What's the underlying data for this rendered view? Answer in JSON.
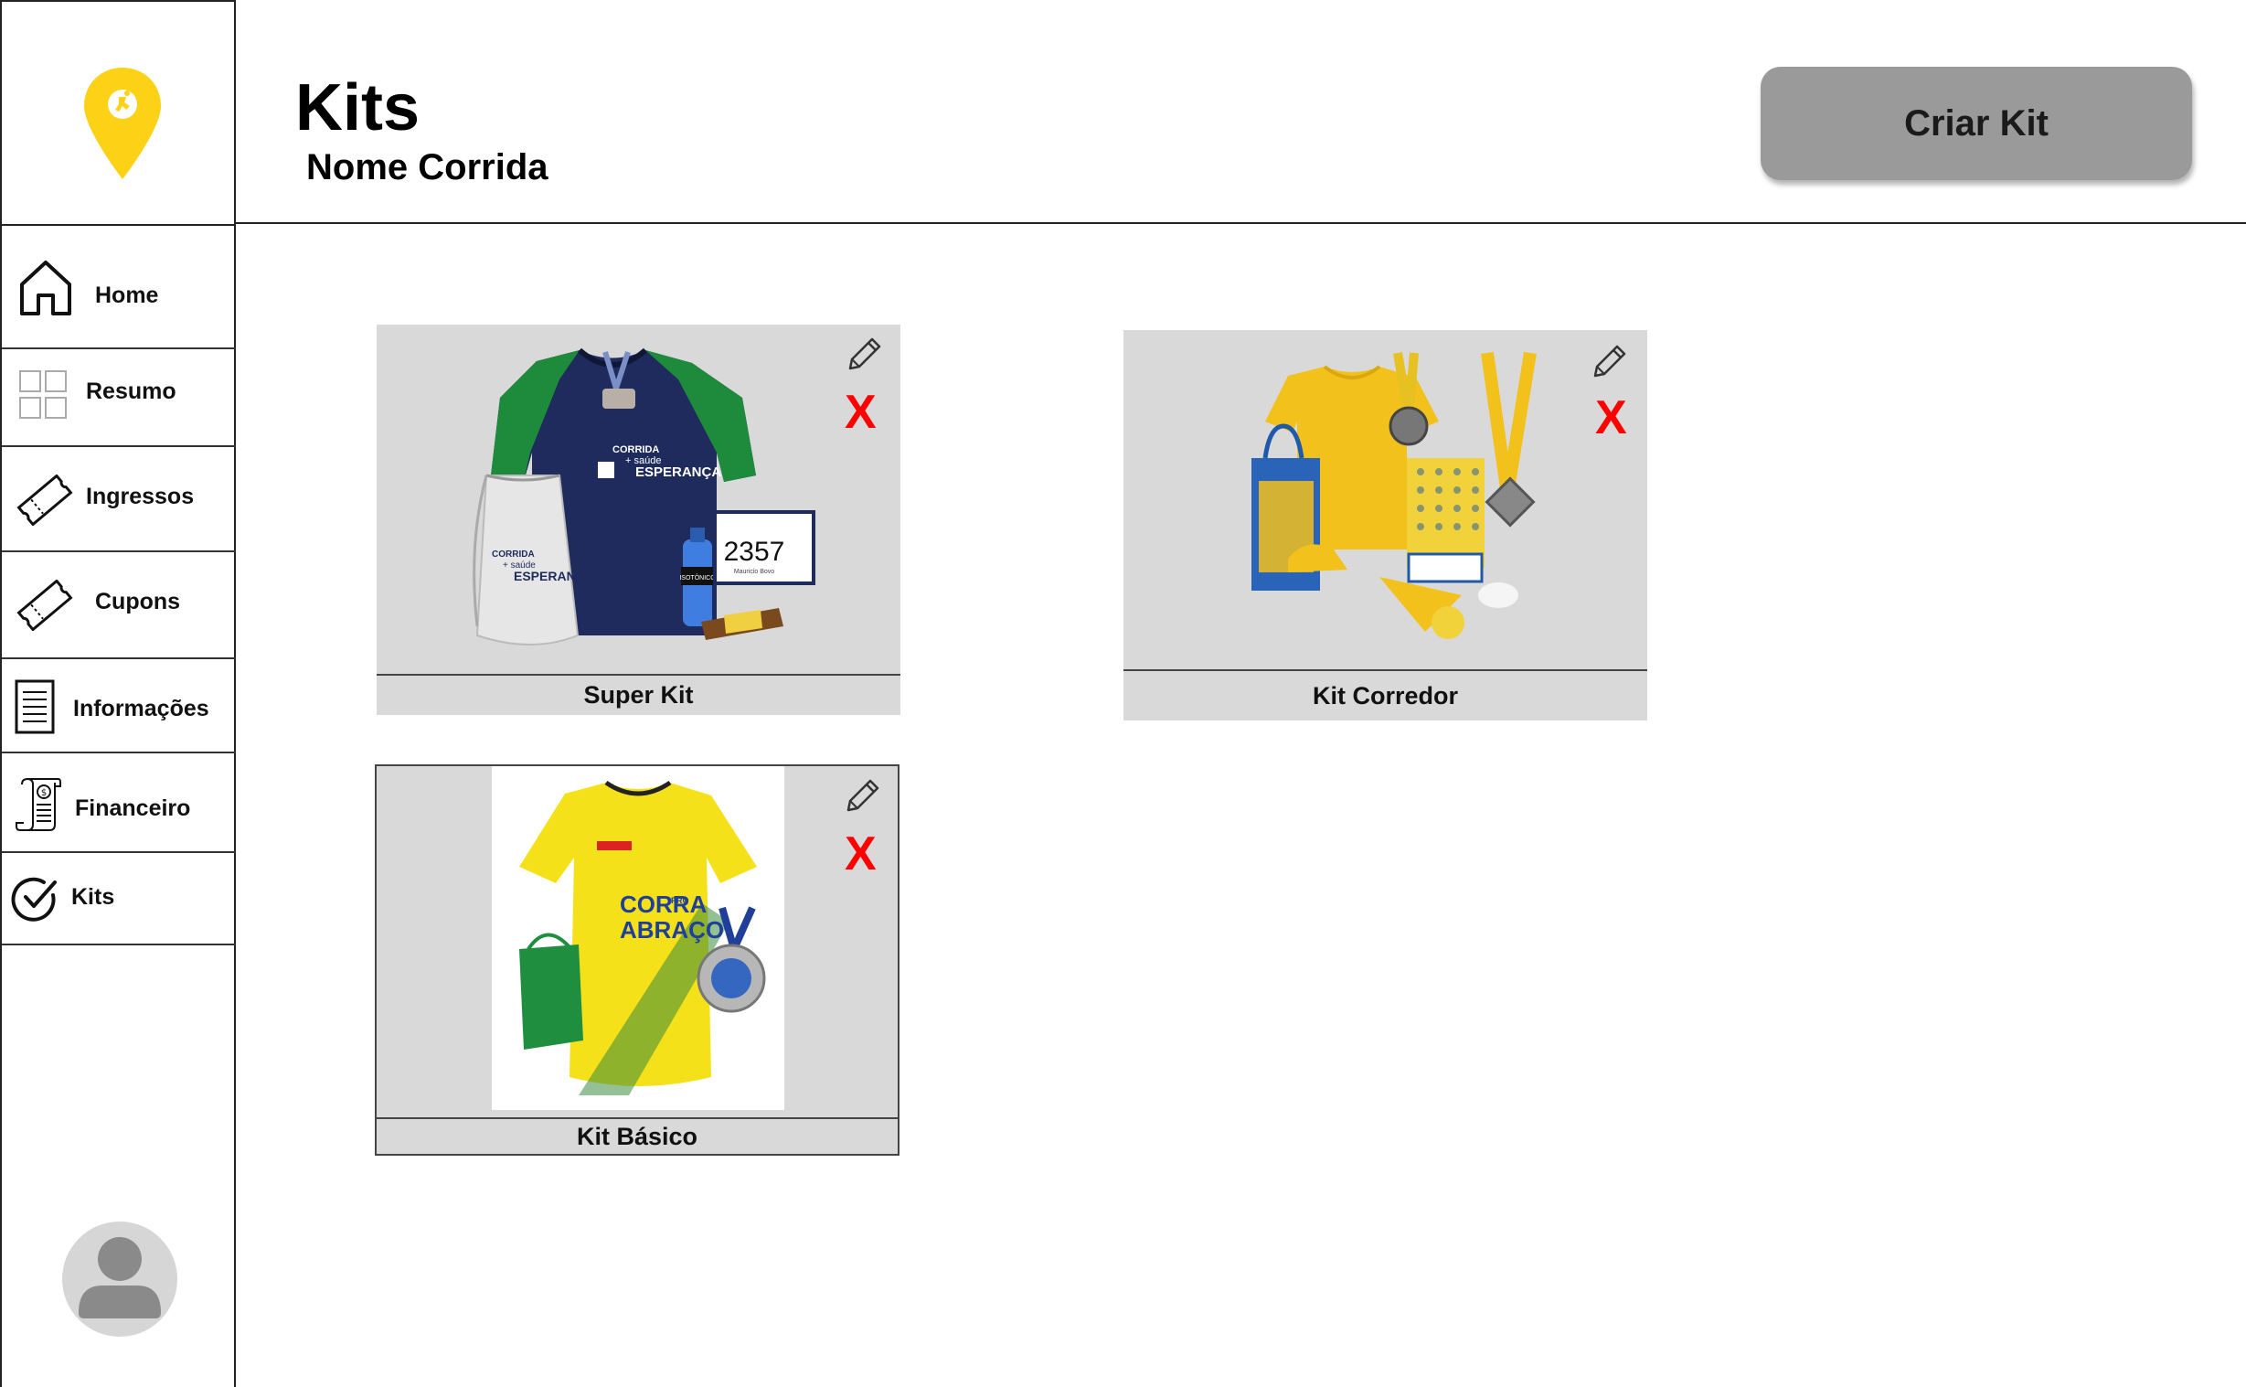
{
  "header": {
    "title": "Kits",
    "subtitle": "Nome Corrida",
    "create_button": "Criar Kit"
  },
  "sidebar": {
    "items": [
      {
        "label": "Home",
        "icon": "home-icon"
      },
      {
        "label": "Resumo",
        "icon": "grid-icon"
      },
      {
        "label": "Ingressos",
        "icon": "ticket-icon"
      },
      {
        "label": "Cupons",
        "icon": "coupon-icon"
      },
      {
        "label": "Informações",
        "icon": "document-icon"
      },
      {
        "label": "Financeiro",
        "icon": "receipt-icon"
      },
      {
        "label": "Kits",
        "icon": "check-circle-icon"
      }
    ]
  },
  "kits": [
    {
      "name": "Super Kit",
      "image_text": {
        "brand_line1": "CORRIDA",
        "brand_line2": "+ saúde",
        "brand_line3": "ESPERANÇA",
        "bib_number": "2357",
        "bib_name": "Mauricio Bovo",
        "bottle_label": "ISOTÔNICO"
      },
      "delete_label": "X"
    },
    {
      "name": "Kit Corredor",
      "delete_label": "X"
    },
    {
      "name": "Kit Básico",
      "image_text": {
        "shirt_line1": "CORRA",
        "shirt_pro": "PRO",
        "shirt_line2": "ABRAÇO"
      },
      "delete_label": "X"
    }
  ],
  "colors": {
    "accent_yellow": "#fcd116",
    "card_gray": "#d9d9d9",
    "button_gray": "#9a9a9a",
    "delete_red": "#ff0000"
  }
}
